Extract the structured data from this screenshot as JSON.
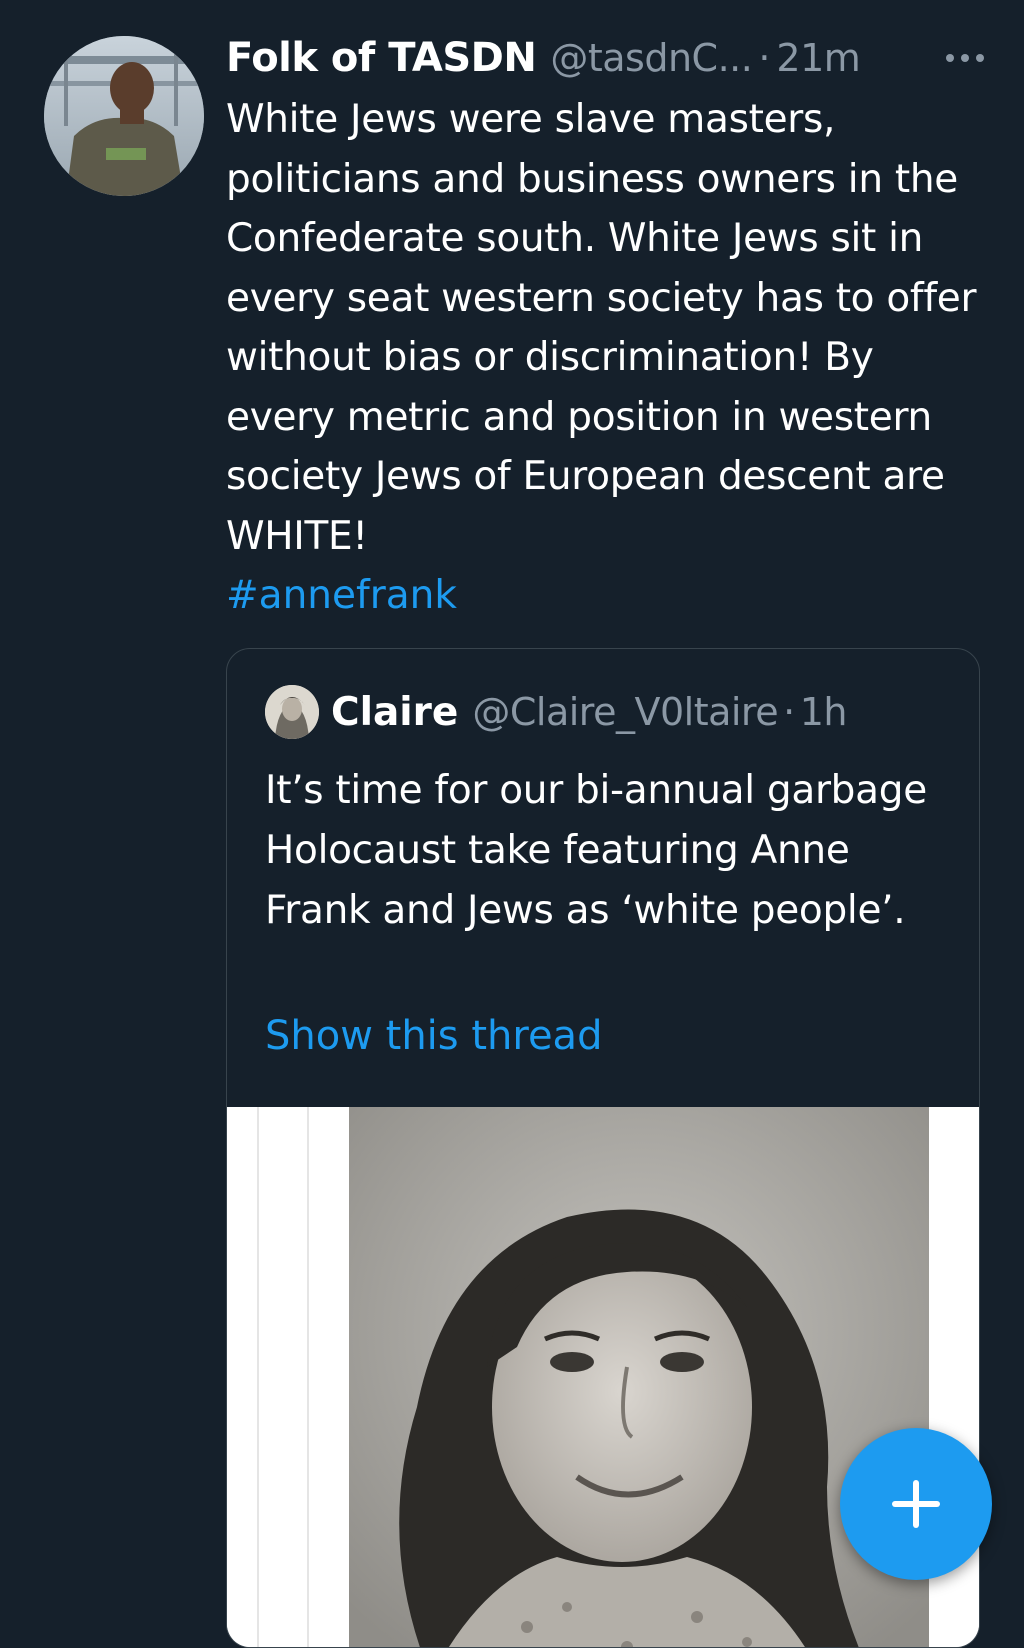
{
  "tweet": {
    "author": {
      "display_name": "Folk of TASDN",
      "handle": "@tasdnC...",
      "avatar_icon": "user-avatar"
    },
    "separator": "·",
    "time": "21m",
    "more_icon": "more-horizontal-icon",
    "text": "White Jews were slave masters, politicians and business owners in the Confederate south. White Jews sit in every seat western society has to offer without bias or discrimination! By every metric and position in western society Jews of European descent are WHITE!",
    "hashtag": "#annefrank"
  },
  "quoted_tweet": {
    "author": {
      "display_name": "Claire",
      "handle": "@Claire_V0ltaire",
      "avatar_icon": "user-avatar"
    },
    "separator": "·",
    "time": "1h",
    "text": "It’s time for our bi-annual garbage Holocaust take featuring Anne Frank and Jews as ‘white people’.",
    "show_thread_label": "Show this thread",
    "media_icon": "black-and-white-portrait-photo"
  },
  "fab": {
    "icon": "plus-icon"
  },
  "colors": {
    "background": "#15202b",
    "text": "#ffffff",
    "secondary_text": "#8b98a5",
    "accent": "#1d9bf0",
    "border": "#38444d"
  }
}
